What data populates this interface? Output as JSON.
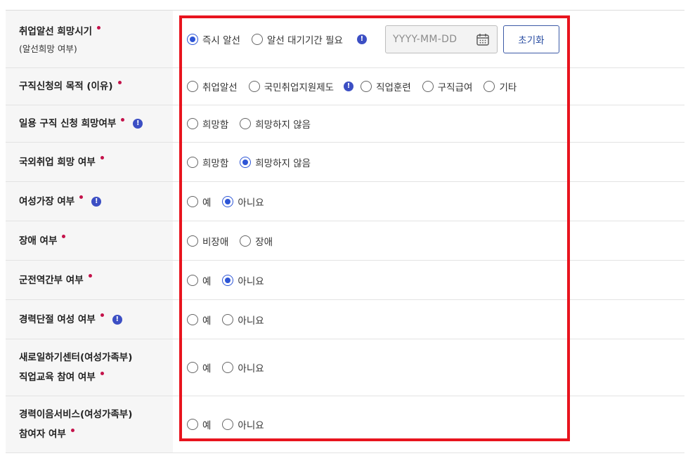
{
  "colors": {
    "required_dot": "#c4124a",
    "info_badge": "#3c4fc4",
    "radio_checked": "#2d55d6",
    "highlight_border": "#e8141e"
  },
  "rows": [
    {
      "label": "취업알선 희망시기",
      "sublabel": "(알선희망 여부)",
      "options": [
        "즉시 알선",
        "알선 대기기간 필요"
      ],
      "selected": 0,
      "date_placeholder": "YYYY-MM-DD",
      "reset_label": "초기화"
    },
    {
      "label": "구직신청의 목적 (이유)",
      "options": [
        "취업알선",
        "국민취업지원제도",
        "직업훈련",
        "구직급여",
        "기타"
      ],
      "selected": null
    },
    {
      "label": "일용 구직 신청 희망여부",
      "options": [
        "희망함",
        "희망하지 않음"
      ],
      "selected": null
    },
    {
      "label": "국외취업 희망 여부",
      "options": [
        "희망함",
        "희망하지 않음"
      ],
      "selected": 1
    },
    {
      "label": "여성가장 여부",
      "options": [
        "예",
        "아니요"
      ],
      "selected": 1
    },
    {
      "label": "장애 여부",
      "options": [
        "비장애",
        "장애"
      ],
      "selected": null
    },
    {
      "label": "군전역간부 여부",
      "options": [
        "예",
        "아니요"
      ],
      "selected": 1
    },
    {
      "label": "경력단절 여성 여부",
      "options": [
        "예",
        "아니요"
      ],
      "selected": null
    },
    {
      "label_lines": [
        "새로일하기센터(여성가족부)",
        "직업교육 참여 여부"
      ],
      "options": [
        "예",
        "아니요"
      ],
      "selected": null
    },
    {
      "label_lines": [
        "경력이음서비스(여성가족부)",
        "참여자 여부"
      ],
      "options": [
        "예",
        "아니요"
      ],
      "selected": null
    }
  ]
}
